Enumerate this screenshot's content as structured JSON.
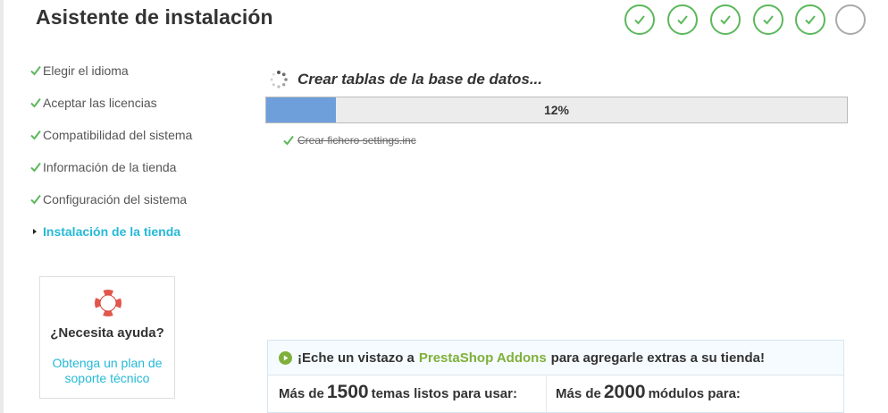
{
  "header": {
    "title": "Asistente de instalación"
  },
  "progress_steps": [
    {
      "status": "done"
    },
    {
      "status": "done"
    },
    {
      "status": "done"
    },
    {
      "status": "done"
    },
    {
      "status": "done"
    },
    {
      "status": "pending"
    }
  ],
  "sidebar": {
    "items": [
      {
        "label": "Elegir el idioma",
        "state": "done"
      },
      {
        "label": "Aceptar las licencias",
        "state": "done"
      },
      {
        "label": "Compatibilidad del sistema",
        "state": "done"
      },
      {
        "label": "Información de la tienda",
        "state": "done"
      },
      {
        "label": "Configuración del sistema",
        "state": "done"
      },
      {
        "label": "Instalación de la tienda",
        "state": "active"
      }
    ]
  },
  "help": {
    "title": "¿Necesita ayuda?",
    "link": "Obtenga un plan de soporte técnico",
    "icon": "lifebuoy-icon"
  },
  "install": {
    "current_task": "Crear tablas de la base de datos...",
    "progress_percent": 12,
    "progress_label": "12%",
    "completed_tasks": [
      "Crear fichero settings.inc"
    ]
  },
  "addons": {
    "intro_before": "¡Eche un vistazo a",
    "brand": "PrestaShop Addons",
    "intro_after": "para agregarle extras a su tienda!",
    "themes_prefix": "Más de",
    "themes_count": "1500",
    "themes_suffix": "temas listos para usar:",
    "modules_prefix": "Más de",
    "modules_count": "2000",
    "modules_suffix": "módulos para:"
  },
  "colors": {
    "success": "#5cb85c",
    "accent": "#25b9d7",
    "progress_fill": "#6f9fdb",
    "addons_brand": "#7fb03a",
    "pending": "#aaaaaa"
  }
}
